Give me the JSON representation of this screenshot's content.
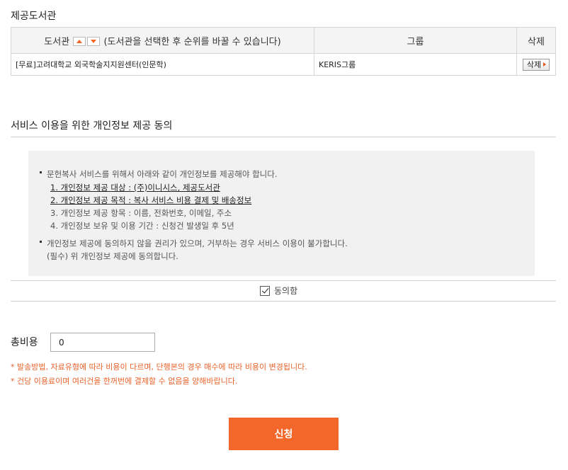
{
  "library_section": {
    "title": "제공도서관",
    "table": {
      "headers": {
        "library_prefix": "도서관",
        "library_suffix": "(도서관을 선택한 후 순위를 바꿀 수 있습니다)",
        "group": "그룹",
        "delete": "삭제"
      },
      "rows": [
        {
          "library": "[무료]고려대학교 외국학술지지원센터(인문학)",
          "group": "KERIS그룹",
          "action": "삭제"
        }
      ]
    }
  },
  "consent_section": {
    "title": "서비스 이용을 위한 개인정보 제공 동의",
    "bullet1": "문헌복사 서비스를 위해서 아래와 같이 개인정보를 제공해야 합니다.",
    "items": [
      "1. 개인정보 제공 대상 : (주)이니시스, 제공도서관",
      "2. 개인정보 제공 목적 : 복사 서비스 비용 결제 및 배송정보",
      "3. 개인정보 제공 항목 : 이름, 전화번호, 이메일, 주소",
      "4. 개인정보 보유 및 이용 기간 : 신청건 발생일 후 5년"
    ],
    "bullet2": "개인정보 제공에 동의하지 않을 권리가 있으며, 거부하는 경우 서비스 이용이 불가합니다.",
    "bullet2_line2": "(필수) 위 개인정보 제공에 동의합니다.",
    "agree_label": "동의함",
    "agree_checked": true
  },
  "fee": {
    "label": "총비용",
    "value": "0",
    "notes": [
      "* 발송방법, 자료유형에 따라 비용이 다르며, 단행본의 경우 매수에 따라 비용이 변경됩니다.",
      "* 건당 이용료이며 여러건을 한꺼번에 결제할 수 없음을 양해바랍니다."
    ]
  },
  "submit_label": "신청",
  "colors": {
    "accent": "#f4672a",
    "note": "#e8632b"
  },
  "icons": {
    "sort_up": "triangle-up",
    "sort_down": "triangle-down",
    "delete_arrow": "triangle-right",
    "check": "checkmark"
  }
}
